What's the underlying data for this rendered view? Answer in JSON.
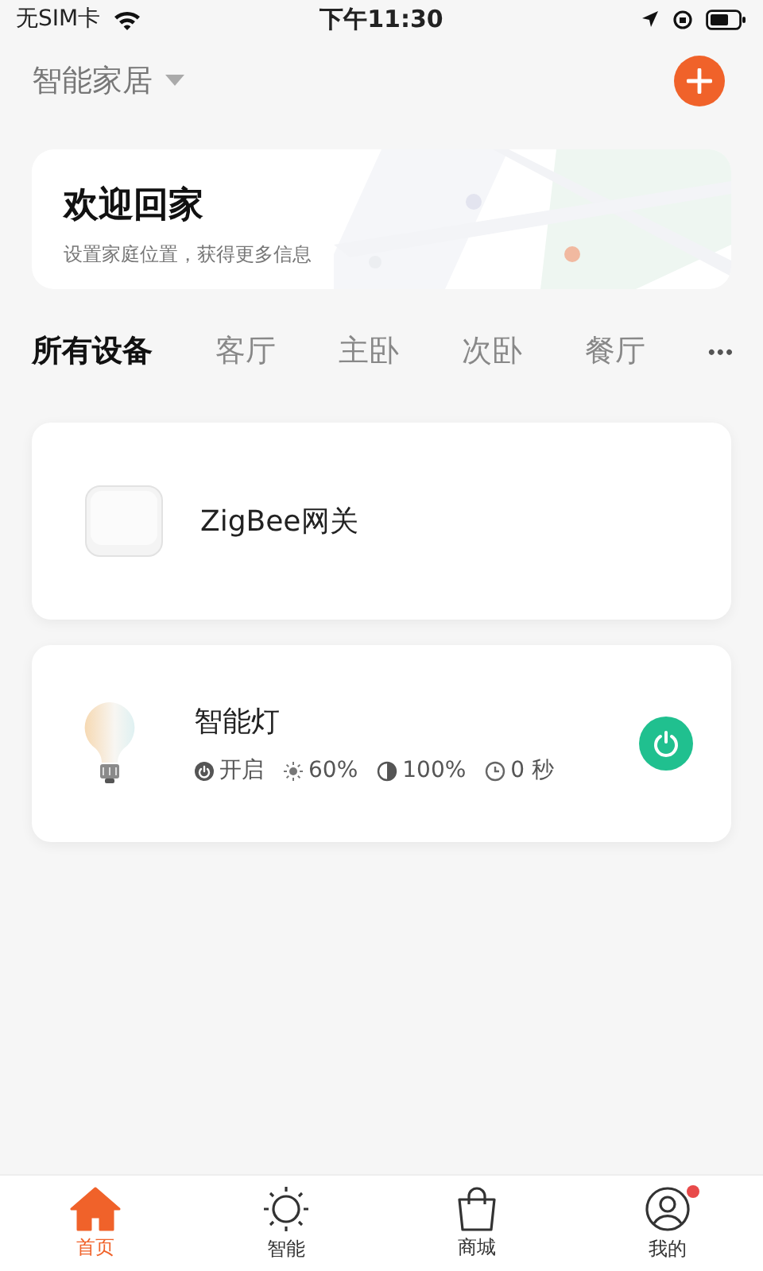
{
  "status_bar": {
    "carrier": "无SIM卡",
    "time": "下午11:30"
  },
  "header": {
    "home_name": "智能家居"
  },
  "welcome": {
    "title": "欢迎回家",
    "subtitle": "设置家庭位置，获得更多信息"
  },
  "rooms": [
    {
      "label": "所有设备",
      "selected": true
    },
    {
      "label": "客厅",
      "selected": false
    },
    {
      "label": "主卧",
      "selected": false
    },
    {
      "label": "次卧",
      "selected": false
    },
    {
      "label": "餐厅",
      "selected": false
    }
  ],
  "more": "•••",
  "devices": [
    {
      "kind": "gateway",
      "name": "ZigBee网关"
    },
    {
      "kind": "light",
      "name": "智能灯",
      "on": true,
      "status": [
        {
          "kind": "power",
          "text": "开启"
        },
        {
          "kind": "brightness",
          "text": "60%"
        },
        {
          "kind": "contrast",
          "text": "100%"
        },
        {
          "kind": "timer",
          "text": "0 秒"
        }
      ]
    }
  ],
  "tab_bar": [
    {
      "kind": "home",
      "label": "首页",
      "selected": true,
      "badge": false
    },
    {
      "kind": "smart",
      "label": "智能",
      "selected": false,
      "badge": false
    },
    {
      "kind": "shop",
      "label": "商城",
      "selected": false,
      "badge": false
    },
    {
      "kind": "me",
      "label": "我的",
      "selected": false,
      "badge": true
    }
  ]
}
